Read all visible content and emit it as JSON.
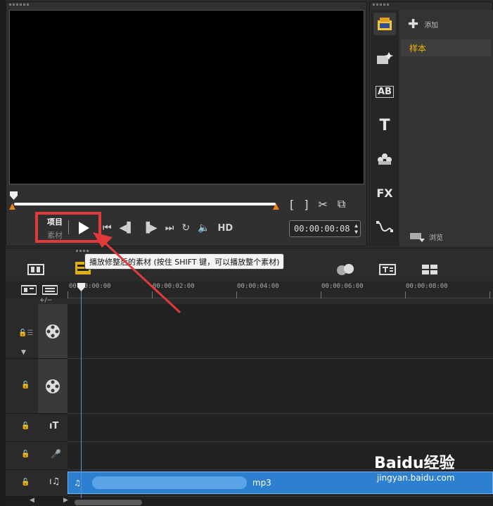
{
  "preview": {
    "mode_project": "项目",
    "mode_clip": "素材",
    "timecode": "00:00:00:08",
    "hd_label": "HD"
  },
  "library": {
    "add_label": "添加",
    "sample_label": "样本",
    "browse_label": "浏览",
    "icons": [
      "media-icon",
      "instant-project-icon",
      "transition-icon",
      "title-icon",
      "graphic-icon",
      "filter-icon",
      "path-icon"
    ],
    "title_glyph": "T",
    "fx_glyph": "FX",
    "ab_glyph": "AB"
  },
  "tooltip": {
    "text": "播放修整后的素材 (按住 SHIFT 键，可以播放整个素材)"
  },
  "timeline": {
    "ruler": [
      "00:00:00:00",
      "00:00:02:00",
      "00:00:04:00",
      "00:00:06:00",
      "00:00:08:00"
    ],
    "zoom_label": "+/−",
    "audio_clip_suffix": "mp3",
    "clip_highlight": "#2d7fd0"
  },
  "watermark": {
    "brand": "Baidu经验",
    "url": "jingyan.baidu.com"
  },
  "colors": {
    "accent_red": "#e03a3a",
    "sample_gold": "#f0b400"
  }
}
